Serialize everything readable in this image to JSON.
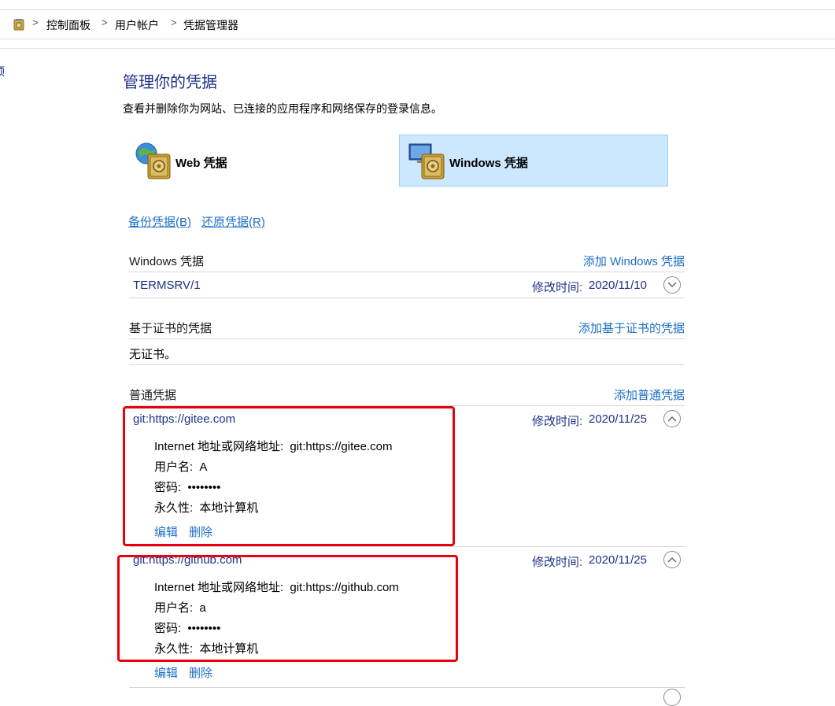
{
  "breadcrumb": {
    "items": [
      "控制面板",
      "用户帐户",
      "凭据管理器"
    ],
    "separator": ">"
  },
  "left_edge_glyph": "顶",
  "header": {
    "title": "管理你的凭据",
    "description": "查看并删除你为网站、已连接的应用程序和网络保存的登录信息。"
  },
  "tiles": {
    "web": {
      "label": "Web 凭据",
      "icon": "web-vault-icon"
    },
    "windows": {
      "label": "Windows 凭据",
      "icon": "windows-vault-icon",
      "selected": true
    }
  },
  "actions": {
    "backup": "备份凭据(B)",
    "restore": "还原凭据(R)"
  },
  "sections": {
    "windows": {
      "title": "Windows 凭据",
      "add_link": "添加 Windows 凭据",
      "items": [
        {
          "name": "TERMSRV/1",
          "modified_label": "修改时间:",
          "modified": "2020/11/10"
        }
      ]
    },
    "cert": {
      "title": "基于证书的凭据",
      "add_link": "添加基于证书的凭据",
      "empty": "无证书。"
    },
    "generic": {
      "title": "普通凭据",
      "add_link": "添加普通凭据",
      "items": [
        {
          "name": "git:https://gitee.com",
          "modified_label": "修改时间:",
          "modified": "2020/11/25",
          "address_label": "Internet 地址或网络地址:",
          "address": "git:https://gitee.com",
          "user_label": "用户名:",
          "user": "A",
          "password_label": "密码:",
          "password": "••••••••",
          "persist_label": "永久性:",
          "persist": "本地计算机",
          "edit": "编辑",
          "delete": "删除"
        },
        {
          "name": "git:https://github.com",
          "modified_label": "修改时间:",
          "modified": "2020/11/25",
          "address_label": "Internet 地址或网络地址:",
          "address": "git:https://github.com",
          "user_label": "用户名:",
          "user": "a",
          "password_label": "密码:",
          "password": "••••••••",
          "persist_label": "永久性:",
          "persist": "本地计算机",
          "edit": "编辑",
          "delete": "删除"
        }
      ]
    }
  },
  "colors": {
    "title_blue": "#1e3287",
    "link_blue": "#1e6fc6",
    "selected_tile_bg": "#cce8ff",
    "annotation_red": "#e60012"
  }
}
